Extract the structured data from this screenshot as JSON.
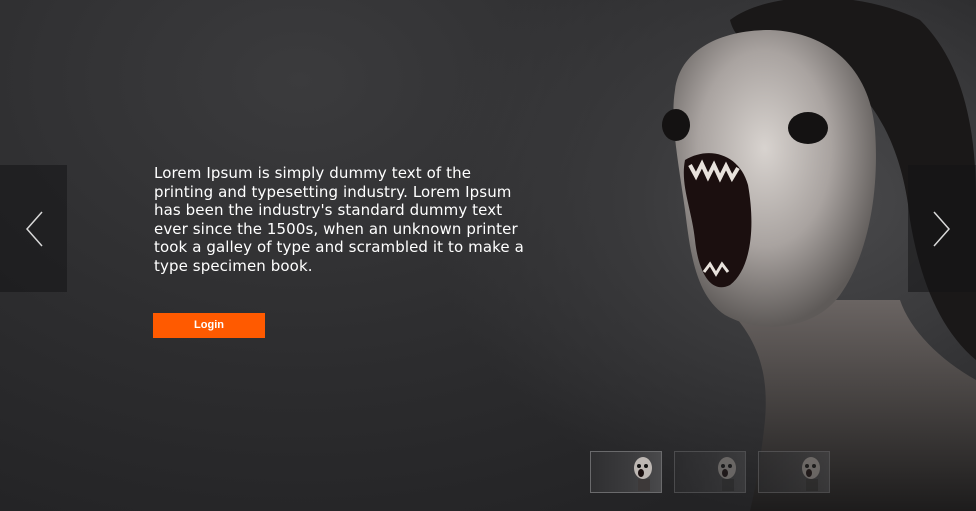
{
  "hero": {
    "description": "Lorem Ipsum is simply dummy text of the printing and typesetting industry. Lorem Ipsum has been the industry's standard dummy text ever since the 1500s, when an unknown printer took a galley of type and scrambled it to make a type specimen book.",
    "cta_label": "Login",
    "accent_color": "#ff5a00"
  },
  "carousel": {
    "prev_icon": "chevron-left-icon",
    "next_icon": "chevron-right-icon",
    "active_index": 0,
    "thumbnail_count": 3
  }
}
